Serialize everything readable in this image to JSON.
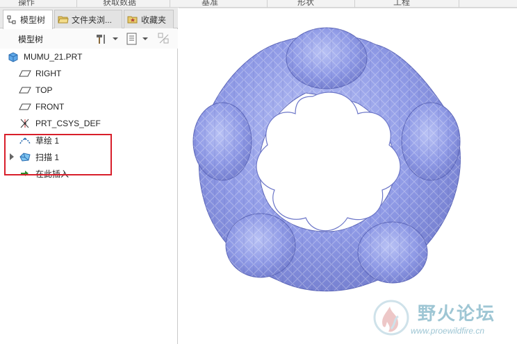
{
  "ribbon": {
    "groups": [
      "操作",
      "获取数据",
      "基准",
      "形状",
      "工程"
    ]
  },
  "tabs": [
    {
      "label": "模型树",
      "active": true
    },
    {
      "label": "文件夹浏...",
      "active": false
    },
    {
      "label": "收藏夹",
      "active": false
    }
  ],
  "toolbar": {
    "title": "模型树"
  },
  "tree": {
    "root": "MUMU_21.PRT",
    "items": [
      {
        "label": "RIGHT",
        "icon": "datum-plane-icon"
      },
      {
        "label": "TOP",
        "icon": "datum-plane-icon"
      },
      {
        "label": "FRONT",
        "icon": "datum-plane-icon"
      },
      {
        "label": "PRT_CSYS_DEF",
        "icon": "csys-icon"
      },
      {
        "label": "草绘 1",
        "icon": "sketch-icon"
      },
      {
        "label": "扫描 1",
        "icon": "sweep-icon"
      },
      {
        "label": "在此插入",
        "icon": "insert-here-icon"
      }
    ]
  },
  "watermark": {
    "title": "野火论坛",
    "url": "www.proewildfire.cn"
  },
  "colors": {
    "model": "#8f9ae6",
    "highlight": "#d81e2a",
    "watermark": "#9ec6d4"
  }
}
